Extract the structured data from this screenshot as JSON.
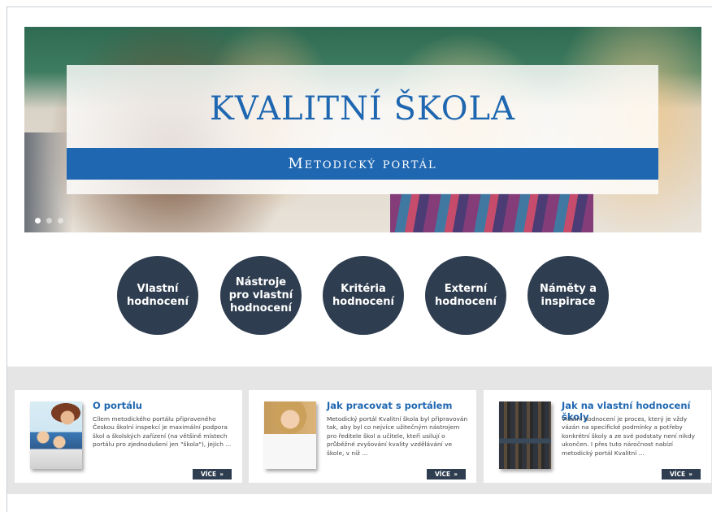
{
  "hero": {
    "title": "KVALITNÍ ŠKOLA",
    "subtitle": "Metodický portál",
    "slide_count": 3,
    "active_slide": 1,
    "colors": {
      "title": "#1f67b1",
      "band": "#1f67b1"
    }
  },
  "nav_circles": [
    {
      "label": "Vlastní\nhodnocení"
    },
    {
      "label": "Nástroje\npro vlastní\nhodnocení"
    },
    {
      "label": "Kritéria\nhodnocení"
    },
    {
      "label": "Externí\nhodnocení"
    },
    {
      "label": "Náměty a\ninspirace"
    }
  ],
  "cards": [
    {
      "title": "O portálu",
      "text": "Cílem metodického portálu připraveného Českou školní inspekcí je maximální podpora škol a školských zařízení  (na většině místech portálu pro zjednodušení jen \"škola\"), jejich ...",
      "more": "VÍCE",
      "more_icon": "»"
    },
    {
      "title": "Jak pracovat s portálem",
      "text": "Metodický portál Kvalitní škola byl připravován tak, aby byl co nejvíce užitečným nástrojem pro ředitele škol a učitele, kteří usilují o průběžné zvyšování kvality vzdělávání ve škole, v níž ...",
      "more": "VÍCE",
      "more_icon": "»"
    },
    {
      "title": "Jak na vlastní hodnocení školy",
      "text": "Vlastní hodnocení je proces, který je vždy vázán na specifické podmínky a potřeby konkrétní školy a ze své podstaty není nikdy ukončen. I přes tuto náročnost nabízí metodický portál Kvalitní ...",
      "more": "VÍCE",
      "more_icon": "»"
    }
  ],
  "colors": {
    "circle_bg": "#2e3d4f",
    "band_bg": "#e5e5e5",
    "card_title": "#1f67b1"
  }
}
